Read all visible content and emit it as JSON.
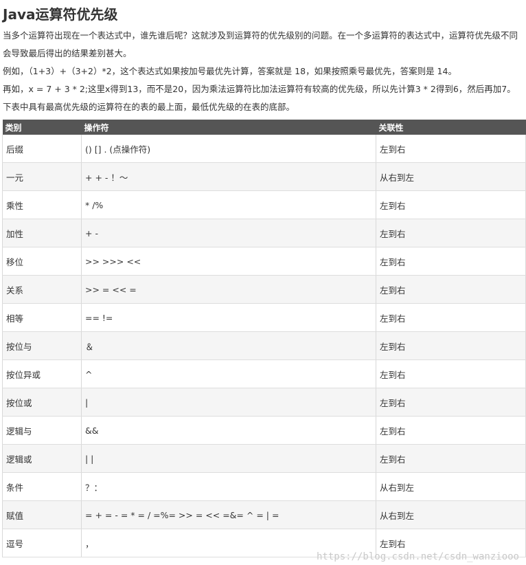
{
  "title": "Java运算符优先级",
  "paragraphs": [
    "当多个运算符出现在一个表达式中，谁先谁后呢？这就涉及到运算符的优先级别的问题。在一个多运算符的表达式中，运算符优先级不同会导致最后得出的结果差别甚大。",
    "例如，（1+3）+（3+2）*2，这个表达式如果按加号最优先计算，答案就是 18，如果按照乘号最优先，答案则是 14。",
    "再如，x = 7 + 3 * 2;这里x得到13，而不是20，因为乘法运算符比加法运算符有较高的优先级，所以先计算3 * 2得到6，然后再加7。",
    "下表中具有最高优先级的运算符在的表的最上面，最低优先级的在表的底部。"
  ],
  "table": {
    "headers": [
      "类别",
      "操作符",
      "关联性"
    ],
    "rows": [
      [
        "后缀",
        "() [] . (点操作符)",
        "左到右"
      ],
      [
        "一元",
        "+ + - ！〜",
        "从右到左"
      ],
      [
        "乘性",
        "* /%",
        "左到右"
      ],
      [
        "加性",
        "+ -",
        "左到右"
      ],
      [
        "移位",
        ">> >>>  <<",
        "左到右"
      ],
      [
        "关系",
        ">> = << =",
        "左到右"
      ],
      [
        "相等",
        "==  !=",
        "左到右"
      ],
      [
        "按位与",
        "＆",
        "左到右"
      ],
      [
        "按位异或",
        "^",
        "左到右"
      ],
      [
        "按位或",
        "|",
        "左到右"
      ],
      [
        "逻辑与",
        "&&",
        "左到右"
      ],
      [
        "逻辑或",
        "| |",
        "左到右"
      ],
      [
        "条件",
        "？：",
        "从右到左"
      ],
      [
        "赋值",
        "= + = - = * = / =%= >> = << =&= ^ = | =",
        "从右到左"
      ],
      [
        "逗号",
        "，",
        "左到右"
      ]
    ]
  },
  "watermark": "https://blog.csdn.net/csdn_wanziooo"
}
